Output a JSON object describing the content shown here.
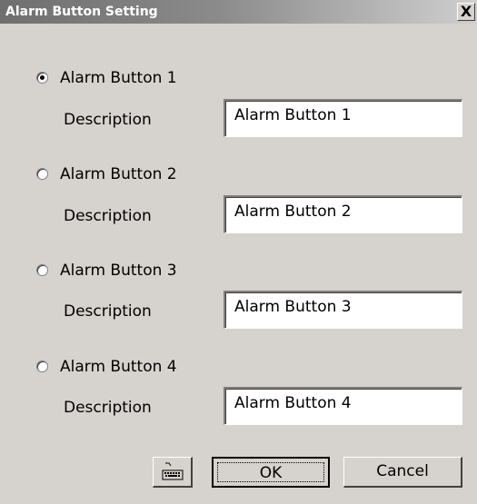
{
  "window": {
    "title": "Alarm Button Setting",
    "close_label": "X"
  },
  "alarm_buttons": [
    {
      "label": "Alarm Button 1",
      "selected": true,
      "description_label": "Description",
      "description_value": "Alarm Button 1"
    },
    {
      "label": "Alarm Button 2",
      "selected": false,
      "description_label": "Description",
      "description_value": "Alarm Button 2"
    },
    {
      "label": "Alarm Button 3",
      "selected": false,
      "description_label": "Description",
      "description_value": "Alarm Button 3"
    },
    {
      "label": "Alarm Button 4",
      "selected": false,
      "description_label": "Description",
      "description_value": "Alarm Button 4"
    }
  ],
  "buttons": {
    "keyboard_icon": "keyboard-icon",
    "ok_label": "OK",
    "cancel_label": "Cancel"
  },
  "colors": {
    "dialog_background": "#d6d3ce",
    "title_text": "#ffffff"
  }
}
